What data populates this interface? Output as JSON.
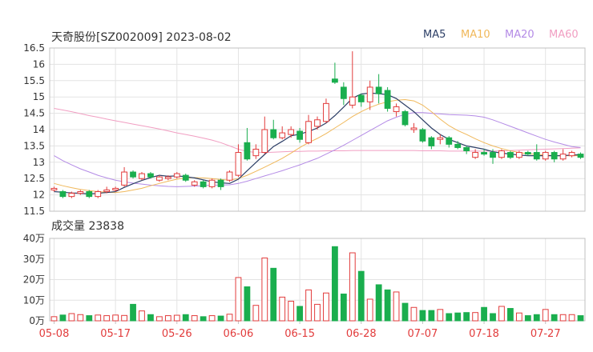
{
  "header": {
    "title": "天奇股份[SZ002009] 2023-08-02"
  },
  "legend": [
    {
      "label": "MA5",
      "color": "#2c3e66"
    },
    {
      "label": "MA10",
      "color": "#f0b85a"
    },
    {
      "label": "MA20",
      "color": "#b48be6"
    },
    {
      "label": "MA60",
      "color": "#f19ec2"
    }
  ],
  "volume": {
    "title": "成交量 23838"
  },
  "colors": {
    "up": "#e23c3c",
    "down": "#1aae4e",
    "grid": "#e3e3e3",
    "axis": "#c0c0c0",
    "text": "#333333",
    "date_text": "#e23c3c"
  },
  "chart_data": [
    {
      "type": "candlestick",
      "ylim": [
        11.5,
        16.5
      ],
      "yticks": [
        "11.5",
        "12",
        "12.5",
        "13",
        "13.5",
        "14",
        "14.5",
        "15",
        "15.5",
        "16",
        "16.5"
      ],
      "x_tick_labels": [
        {
          "label": "05-08",
          "index": 0
        },
        {
          "label": "05-17",
          "index": 7
        },
        {
          "label": "05-26",
          "index": 14
        },
        {
          "label": "06-06",
          "index": 21
        },
        {
          "label": "06-15",
          "index": 28
        },
        {
          "label": "06-28",
          "index": 35
        },
        {
          "label": "07-07",
          "index": 42
        },
        {
          "label": "07-18",
          "index": 49
        },
        {
          "label": "07-27",
          "index": 56
        }
      ],
      "candles": [
        [
          12.15,
          12.2,
          12.25,
          12.1
        ],
        [
          12.1,
          11.95,
          12.15,
          11.9
        ],
        [
          11.95,
          12.05,
          12.1,
          11.9
        ],
        [
          12.05,
          12.1,
          12.15,
          12.0
        ],
        [
          12.1,
          11.95,
          12.15,
          11.9
        ],
        [
          11.95,
          12.1,
          12.15,
          11.9
        ],
        [
          12.1,
          12.15,
          12.25,
          12.05
        ],
        [
          12.15,
          12.2,
          12.25,
          12.1
        ],
        [
          12.3,
          12.7,
          12.85,
          12.25
        ],
        [
          12.7,
          12.55,
          12.75,
          12.5
        ],
        [
          12.5,
          12.65,
          12.7,
          12.45
        ],
        [
          12.65,
          12.55,
          12.7,
          12.5
        ],
        [
          12.45,
          12.55,
          12.6,
          12.4
        ],
        [
          12.5,
          12.55,
          12.6,
          12.45
        ],
        [
          12.55,
          12.65,
          12.7,
          12.5
        ],
        [
          12.6,
          12.45,
          12.65,
          12.4
        ],
        [
          12.3,
          12.4,
          12.45,
          12.25
        ],
        [
          12.4,
          12.25,
          12.45,
          12.2
        ],
        [
          12.25,
          12.45,
          12.5,
          12.2
        ],
        [
          12.45,
          12.25,
          12.5,
          12.15
        ],
        [
          12.45,
          12.7,
          12.75,
          12.4
        ],
        [
          12.6,
          13.3,
          13.55,
          12.55
        ],
        [
          13.6,
          13.1,
          14.05,
          13.05
        ],
        [
          13.2,
          13.4,
          13.55,
          13.1
        ],
        [
          13.3,
          14.0,
          14.4,
          13.25
        ],
        [
          14.0,
          13.75,
          14.3,
          13.7
        ],
        [
          13.75,
          13.9,
          14.1,
          13.7
        ],
        [
          13.85,
          14.0,
          14.1,
          13.75
        ],
        [
          13.95,
          13.7,
          14.05,
          13.6
        ],
        [
          13.6,
          14.25,
          14.45,
          13.55
        ],
        [
          14.1,
          14.3,
          14.4,
          14.0
        ],
        [
          14.25,
          14.8,
          14.95,
          14.2
        ],
        [
          15.55,
          15.45,
          16.05,
          15.4
        ],
        [
          15.3,
          14.95,
          15.45,
          14.75
        ],
        [
          14.75,
          15.0,
          16.4,
          14.65
        ],
        [
          15.05,
          14.85,
          15.1,
          14.7
        ],
        [
          14.85,
          15.3,
          15.5,
          14.6
        ],
        [
          15.3,
          15.1,
          15.7,
          14.8
        ],
        [
          15.2,
          14.65,
          15.3,
          14.55
        ],
        [
          14.55,
          14.7,
          14.8,
          14.4
        ],
        [
          14.55,
          14.15,
          14.6,
          14.1
        ],
        [
          14.0,
          14.05,
          14.2,
          13.9
        ],
        [
          14.0,
          13.65,
          14.05,
          13.6
        ],
        [
          13.75,
          13.5,
          13.8,
          13.4
        ],
        [
          13.7,
          13.75,
          13.85,
          13.55
        ],
        [
          13.75,
          13.55,
          13.8,
          13.45
        ],
        [
          13.55,
          13.45,
          13.65,
          13.4
        ],
        [
          13.45,
          13.35,
          13.5,
          13.25
        ],
        [
          13.15,
          13.3,
          13.4,
          13.1
        ],
        [
          13.3,
          13.25,
          13.4,
          13.2
        ],
        [
          13.3,
          13.15,
          13.4,
          12.95
        ],
        [
          13.15,
          13.35,
          13.4,
          13.1
        ],
        [
          13.3,
          13.15,
          13.35,
          13.1
        ],
        [
          13.15,
          13.3,
          13.35,
          13.1
        ],
        [
          13.3,
          13.25,
          13.35,
          13.2
        ],
        [
          13.3,
          13.1,
          13.55,
          13.05
        ],
        [
          13.1,
          13.3,
          13.35,
          13.05
        ],
        [
          13.3,
          13.1,
          13.35,
          13.0
        ],
        [
          13.1,
          13.25,
          13.4,
          13.05
        ],
        [
          13.2,
          13.3,
          13.35,
          13.15
        ],
        [
          13.25,
          13.15,
          13.3,
          13.1
        ]
      ],
      "ma5": [
        12.1,
        12.08,
        12.06,
        12.05,
        12.03,
        12.05,
        12.07,
        12.1,
        12.23,
        12.34,
        12.44,
        12.53,
        12.6,
        12.57,
        12.58,
        12.56,
        12.52,
        12.46,
        12.4,
        12.37,
        12.35,
        12.48,
        12.74,
        12.99,
        13.24,
        13.48,
        13.64,
        13.81,
        13.86,
        13.94,
        14.05,
        14.2,
        14.43,
        14.69,
        14.96,
        15.09,
        15.12,
        15.1,
        15.07,
        14.95,
        14.75,
        14.55,
        14.3,
        14.05,
        13.85,
        13.7,
        13.6,
        13.5,
        13.45,
        13.4,
        13.32,
        13.28,
        13.25,
        13.22,
        13.2,
        13.2,
        13.2,
        13.2,
        13.2,
        13.22,
        13.23
      ],
      "ma10": [
        12.35,
        12.28,
        12.22,
        12.17,
        12.13,
        12.1,
        12.08,
        12.07,
        12.1,
        12.15,
        12.2,
        12.28,
        12.35,
        12.42,
        12.48,
        12.52,
        12.53,
        12.52,
        12.5,
        12.47,
        12.45,
        12.5,
        12.6,
        12.72,
        12.85,
        12.98,
        13.12,
        13.28,
        13.45,
        13.6,
        13.73,
        13.88,
        14.05,
        14.22,
        14.4,
        14.55,
        14.68,
        14.78,
        14.85,
        14.9,
        14.92,
        14.88,
        14.75,
        14.55,
        14.32,
        14.12,
        13.97,
        13.85,
        13.72,
        13.6,
        13.5,
        13.42,
        13.35,
        13.3,
        13.26,
        13.24,
        13.22,
        13.2,
        13.2,
        13.2,
        13.2
      ],
      "ma20": [
        13.2,
        13.05,
        12.92,
        12.8,
        12.7,
        12.6,
        12.52,
        12.45,
        12.4,
        12.36,
        12.33,
        12.3,
        12.28,
        12.26,
        12.25,
        12.26,
        12.27,
        12.28,
        12.3,
        12.3,
        12.31,
        12.35,
        12.42,
        12.5,
        12.58,
        12.66,
        12.74,
        12.83,
        12.92,
        13.02,
        13.12,
        13.25,
        13.38,
        13.52,
        13.67,
        13.82,
        13.97,
        14.12,
        14.27,
        14.38,
        14.47,
        14.52,
        14.52,
        14.5,
        14.48,
        14.46,
        14.45,
        14.44,
        14.42,
        14.38,
        14.3,
        14.2,
        14.1,
        14.0,
        13.9,
        13.8,
        13.7,
        13.62,
        13.55,
        13.48,
        13.45
      ],
      "ma60": [
        14.65,
        14.6,
        14.55,
        14.49,
        14.43,
        14.38,
        14.32,
        14.27,
        14.22,
        14.17,
        14.12,
        14.07,
        14.02,
        13.96,
        13.9,
        13.85,
        13.8,
        13.74,
        13.68,
        13.6,
        13.5,
        13.4,
        13.33,
        13.3,
        13.3,
        13.31,
        13.32,
        13.33,
        13.33,
        13.34,
        13.34,
        13.35,
        13.35,
        13.35,
        13.36,
        13.36,
        13.36,
        13.36,
        13.36,
        13.36,
        13.36,
        13.36,
        13.35,
        13.35,
        13.35,
        13.34,
        13.34,
        13.34,
        13.34,
        13.34,
        13.34,
        13.35,
        13.36,
        13.37,
        13.38,
        13.39,
        13.4,
        13.41,
        13.42,
        13.43,
        13.44
      ]
    },
    {
      "type": "bar",
      "ylim": [
        0,
        40
      ],
      "yticks": [
        "0万",
        "10万",
        "20万",
        "30万",
        "40万"
      ],
      "values": [
        2.0,
        2.8,
        3.5,
        3.0,
        2.5,
        2.8,
        2.5,
        2.8,
        2.6,
        8.0,
        4.8,
        3.0,
        2.0,
        2.5,
        2.7,
        3.0,
        2.5,
        2.0,
        2.5,
        2.3,
        3.2,
        21.0,
        16.5,
        7.5,
        30.5,
        25.5,
        11.5,
        9.5,
        7.0,
        15.0,
        8.0,
        13.5,
        36.0,
        13.0,
        33.0,
        24.0,
        10.5,
        17.5,
        15.0,
        14.0,
        8.5,
        6.5,
        5.0,
        5.0,
        5.5,
        3.5,
        3.8,
        4.0,
        4.0,
        6.5,
        3.5,
        7.0,
        6.0,
        3.8,
        2.5,
        3.0,
        5.5,
        3.0,
        3.0,
        3.0,
        2.5
      ]
    }
  ]
}
